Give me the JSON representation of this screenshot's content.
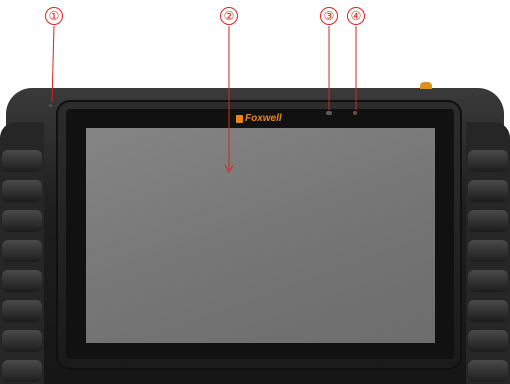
{
  "brand": {
    "name": "Foxwell"
  },
  "callouts": [
    {
      "label": "①"
    },
    {
      "label": "②"
    },
    {
      "label": "③"
    },
    {
      "label": "④"
    }
  ],
  "colors": {
    "callout": "#d7261e",
    "brand": "#e8851a",
    "screen": "#7b7b7b",
    "housing": "#1e1e1e"
  }
}
